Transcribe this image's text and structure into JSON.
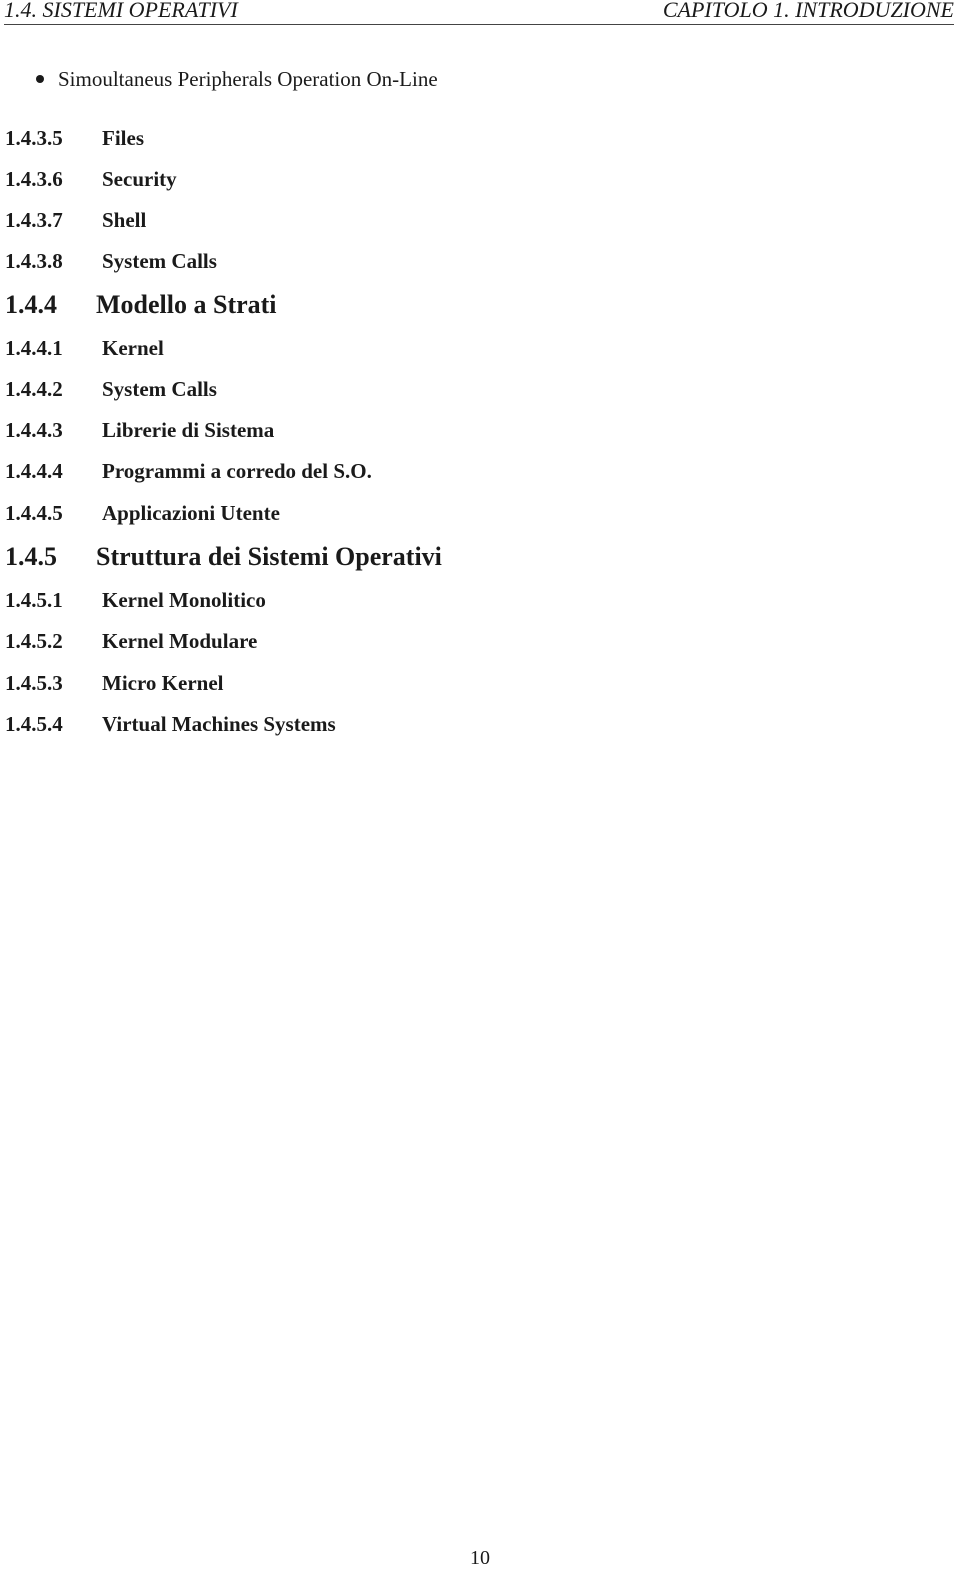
{
  "header": {
    "left": "1.4.  SISTEMI OPERATIVI",
    "right": "CAPITOLO 1.  INTRODUZIONE"
  },
  "bullet": {
    "text": "Simoultaneus Peripherals Operation On-Line"
  },
  "sections": [
    {
      "number": "1.4.3.5",
      "title": "Files",
      "level": "subsub"
    },
    {
      "number": "1.4.3.6",
      "title": "Security",
      "level": "subsub"
    },
    {
      "number": "1.4.3.7",
      "title": "Shell",
      "level": "subsub"
    },
    {
      "number": "1.4.3.8",
      "title": "System Calls",
      "level": "subsub"
    },
    {
      "number": "1.4.4",
      "title": "Modello a Strati",
      "level": "sub"
    },
    {
      "number": "1.4.4.1",
      "title": "Kernel",
      "level": "subsub"
    },
    {
      "number": "1.4.4.2",
      "title": "System Calls",
      "level": "subsub"
    },
    {
      "number": "1.4.4.3",
      "title": "Librerie di Sistema",
      "level": "subsub"
    },
    {
      "number": "1.4.4.4",
      "title": "Programmi a corredo del S.O.",
      "level": "subsub"
    },
    {
      "number": "1.4.4.5",
      "title": "Applicazioni Utente",
      "level": "subsub"
    },
    {
      "number": "1.4.5",
      "title": "Struttura dei Sistemi Operativi",
      "level": "sub"
    },
    {
      "number": "1.4.5.1",
      "title": "Kernel Monolitico",
      "level": "subsub"
    },
    {
      "number": "1.4.5.2",
      "title": "Kernel Modulare",
      "level": "subsub"
    },
    {
      "number": "1.4.5.3",
      "title": "Micro Kernel",
      "level": "subsub"
    },
    {
      "number": "1.4.5.4",
      "title": "Virtual Machines Systems",
      "level": "subsub"
    }
  ],
  "page_number": "10"
}
